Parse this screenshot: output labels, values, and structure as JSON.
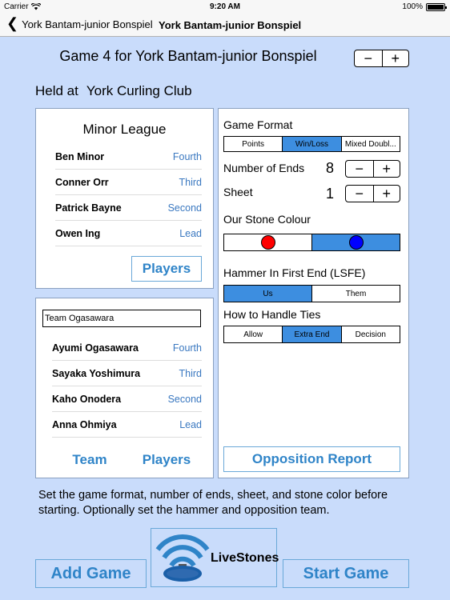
{
  "status": {
    "carrier": "Carrier",
    "time": "9:20 AM",
    "battery": "100%"
  },
  "nav": {
    "back_label": "York Bantam-junior Bonspiel",
    "title": "York Bantam-junior Bonspiel"
  },
  "header": {
    "game_title": "Game 4 for York Bantam-junior Bonspiel",
    "minus": "−",
    "plus": "+",
    "held_label": "Held at",
    "held_value": "York Curling Club"
  },
  "league": {
    "title": "Minor League",
    "players": [
      {
        "name": "Ben Minor",
        "position": "Fourth"
      },
      {
        "name": "Conner Orr",
        "position": "Third"
      },
      {
        "name": "Patrick Bayne",
        "position": "Second"
      },
      {
        "name": "Owen Ing",
        "position": "Lead"
      }
    ],
    "players_button": "Players"
  },
  "opponent": {
    "team_name": "Team Ogasawara",
    "players": [
      {
        "name": "Ayumi  Ogasawara",
        "position": "Fourth"
      },
      {
        "name": "Sayaka Yoshimura",
        "position": "Third"
      },
      {
        "name": "Kaho Onodera",
        "position": "Second"
      },
      {
        "name": "Anna Ohmiya",
        "position": "Lead"
      }
    ],
    "team_button": "Team",
    "players_button": "Players"
  },
  "settings": {
    "game_format_label": "Game Format",
    "format_options": [
      "Points",
      "Win/Loss",
      "Mixed Doubl..."
    ],
    "format_selected": 1,
    "ends_label": "Number of Ends",
    "ends_value": "8",
    "sheet_label": "Sheet",
    "sheet_value": "1",
    "stone_colour_label": "Our Stone Colour",
    "stone_colours": [
      "#ff0000",
      "#0000ff"
    ],
    "stone_selected": 1,
    "hammer_label": "Hammer In First End (LSFE)",
    "hammer_options": [
      "Us",
      "Them"
    ],
    "hammer_selected": 0,
    "ties_label": "How to Handle Ties",
    "ties_options": [
      "Allow",
      "Extra End",
      "Decision"
    ],
    "ties_selected": 1,
    "opposition_report": "Opposition Report"
  },
  "help_text": "Set the game format, number of ends, sheet, and stone color before starting. Optionally set the hammer and opposition team.",
  "footer": {
    "add_game": "Add Game",
    "start_game": "Start Game",
    "logo_text": "LiveStones"
  },
  "colors": {
    "accent": "#2f84c8",
    "selected": "#3d8ee0",
    "background": "#c9dcfb"
  }
}
